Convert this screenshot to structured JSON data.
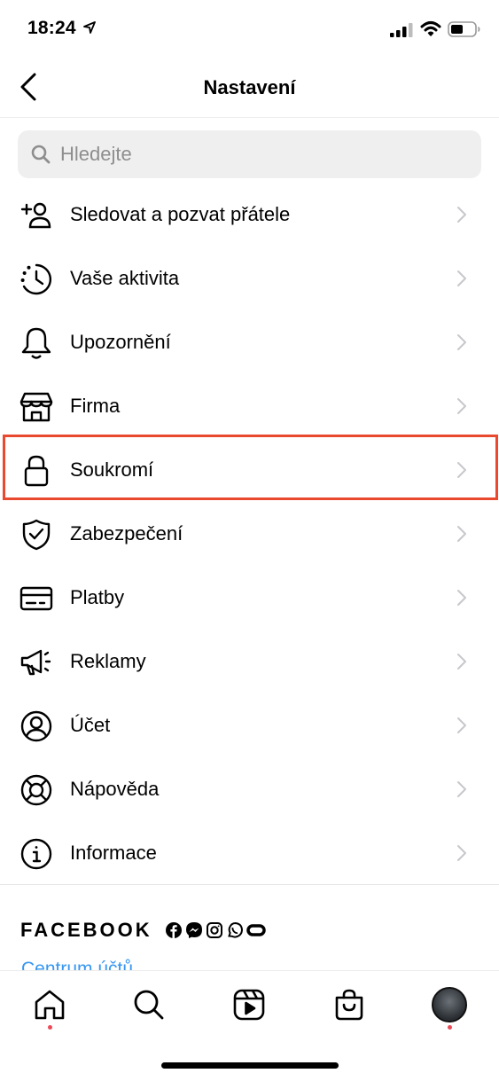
{
  "status_bar": {
    "time": "18:24"
  },
  "nav": {
    "title": "Nastavení",
    "back_icon": "chevron-left-icon"
  },
  "search": {
    "placeholder": "Hledejte"
  },
  "menu": [
    {
      "label": "Sledovat a pozvat přátele",
      "icon": "add-person-icon"
    },
    {
      "label": "Vaše aktivita",
      "icon": "activity-clock-icon"
    },
    {
      "label": "Upozornění",
      "icon": "bell-icon"
    },
    {
      "label": "Firma",
      "icon": "shop-icon"
    },
    {
      "label": "Soukromí",
      "icon": "lock-icon",
      "highlighted": true
    },
    {
      "label": "Zabezpečení",
      "icon": "shield-check-icon"
    },
    {
      "label": "Platby",
      "icon": "credit-card-icon"
    },
    {
      "label": "Reklamy",
      "icon": "megaphone-icon"
    },
    {
      "label": "Účet",
      "icon": "account-circle-icon"
    },
    {
      "label": "Nápověda",
      "icon": "lifebuoy-icon"
    },
    {
      "label": "Informace",
      "icon": "info-icon"
    }
  ],
  "footer": {
    "brand": "FACEBOOK",
    "link": "Centrum účtů"
  },
  "tabbar": {
    "items": [
      "home",
      "search",
      "reels",
      "shop",
      "profile"
    ]
  },
  "colors": {
    "highlight": "#e8492f",
    "link": "#3897f0",
    "notification_dot": "#ed4956"
  }
}
